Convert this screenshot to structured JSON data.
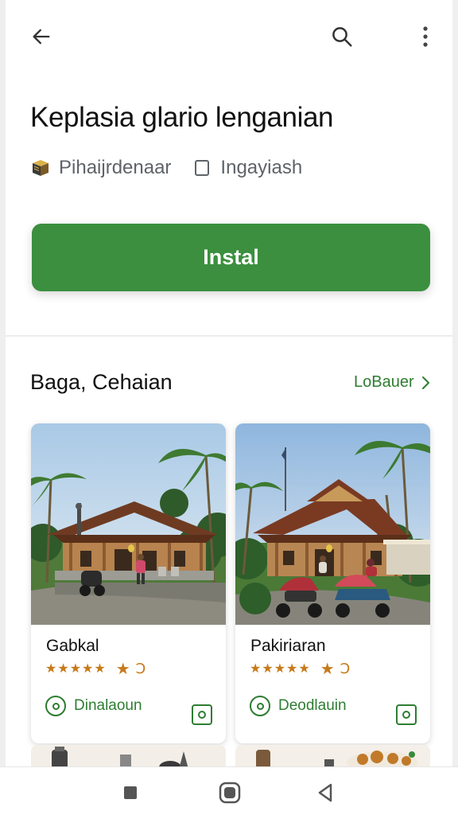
{
  "topbar": {
    "back_icon": "arrow-left-icon",
    "search_icon": "search-icon",
    "more_icon": "more-vertical-icon"
  },
  "app": {
    "title": "Keplasia glario lenganian",
    "developer": "Pihaijrdenaar",
    "category": "Ingayiash",
    "developer_icon": "book-icon",
    "category_icon": "checkbox-icon"
  },
  "install": {
    "label": "Instal",
    "color": "#3b8f3e"
  },
  "section": {
    "title": "Baga, Cehaian",
    "see_more": "LoBauer"
  },
  "cards": [
    {
      "name": "Gabkal",
      "stars": "★★★★★",
      "badge": "★",
      "rating_suffix": "Ↄ",
      "tag": "Dinalaoun",
      "tag_icon": "location-ring-icon",
      "share_icon": "share-icon"
    },
    {
      "name": "Pakiriaran",
      "stars": "★★★★★",
      "badge": "★",
      "rating_suffix": "Ↄ",
      "tag": "Deodlauin",
      "tag_icon": "location-ring-icon",
      "share_icon": "share-icon"
    }
  ],
  "colors": {
    "accent": "#2e7d32",
    "star": "#c77a1a",
    "text": "#202124"
  },
  "navbar": {
    "square_icon": "recents-icon",
    "home_icon": "home-icon",
    "back_icon": "nav-back-icon"
  }
}
